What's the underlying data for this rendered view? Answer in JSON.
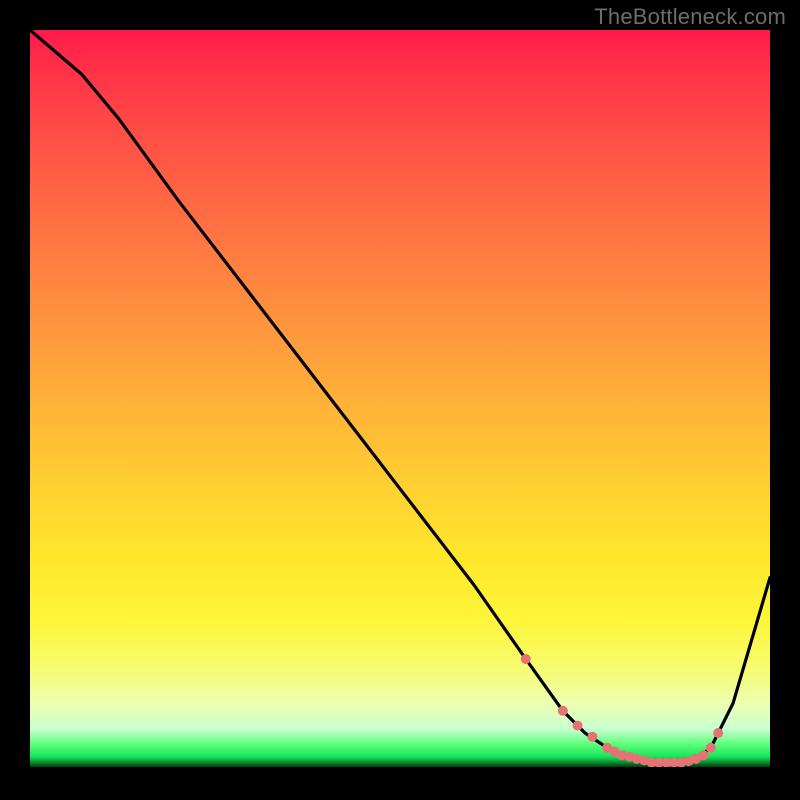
{
  "watermark": "TheBottleneck.com",
  "chart_data": {
    "type": "line",
    "title": "",
    "xlabel": "",
    "ylabel": "",
    "xlim": [
      0,
      100
    ],
    "ylim": [
      0,
      100
    ],
    "grid": false,
    "legend": false,
    "background_gradient": [
      "#ff1a4b",
      "#ff9a3d",
      "#ffe82c",
      "#edffb0",
      "#16e55a",
      "#000000"
    ],
    "series": [
      {
        "name": "bottleneck-curve",
        "color": "#000000",
        "x": [
          0,
          7,
          12,
          20,
          30,
          40,
          50,
          60,
          67,
          72,
          75,
          78,
          80,
          82,
          84,
          86,
          88,
          90,
          92,
          95,
          100
        ],
        "values": [
          100,
          94,
          88,
          77,
          64,
          51,
          38,
          25,
          15,
          8,
          5,
          3,
          2,
          1.5,
          1,
          1,
          1,
          1.5,
          3,
          9,
          26
        ]
      }
    ],
    "markers": {
      "color": "#e67373",
      "x": [
        67,
        72,
        74,
        76,
        78,
        79,
        80,
        81,
        82,
        83,
        84,
        85,
        86,
        87,
        88,
        89,
        90,
        91,
        92,
        93
      ],
      "values": [
        15,
        8,
        6,
        4.5,
        3,
        2.5,
        2,
        1.8,
        1.5,
        1.3,
        1,
        1,
        1,
        1,
        1,
        1.2,
        1.5,
        2,
        3,
        5
      ]
    }
  }
}
